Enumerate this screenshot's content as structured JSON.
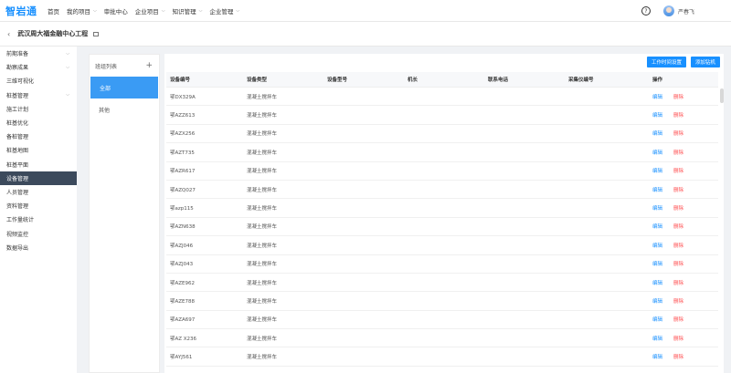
{
  "topbar": {
    "logo": "智岩通",
    "nav": [
      {
        "label": "首页",
        "dropdown": false
      },
      {
        "label": "我的项目",
        "dropdown": true
      },
      {
        "label": "审批中心",
        "dropdown": false
      },
      {
        "label": "企业项目",
        "dropdown": true
      },
      {
        "label": "知识管理",
        "dropdown": true
      },
      {
        "label": "企业管理",
        "dropdown": true
      }
    ],
    "help": "?",
    "user_name": "严春飞"
  },
  "project": {
    "back": "‹",
    "title": "武汉周大福金融中心工程"
  },
  "menu": [
    {
      "label": "前期准备",
      "dropdown": true,
      "active": false
    },
    {
      "label": "勘察成果",
      "dropdown": true,
      "active": false
    },
    {
      "label": "三维可视化",
      "dropdown": false,
      "active": false
    },
    {
      "label": "桩基管理",
      "dropdown": true,
      "active": false
    },
    {
      "label": "施工计划",
      "dropdown": false,
      "active": false
    },
    {
      "label": "桩基优化",
      "dropdown": false,
      "active": false
    },
    {
      "label": "备桩管理",
      "dropdown": false,
      "active": false
    },
    {
      "label": "桩基地图",
      "dropdown": false,
      "active": false
    },
    {
      "label": "桩基平面",
      "dropdown": false,
      "active": false
    },
    {
      "label": "设备管理",
      "dropdown": false,
      "active": true
    },
    {
      "label": "人员管理",
      "dropdown": false,
      "active": false
    },
    {
      "label": "资料管理",
      "dropdown": false,
      "active": false
    },
    {
      "label": "工作量统计",
      "dropdown": false,
      "active": false
    },
    {
      "label": "视频监控",
      "dropdown": false,
      "active": false
    },
    {
      "label": "数据导出",
      "dropdown": false,
      "active": false
    }
  ],
  "groups": {
    "title": "班组列表",
    "add": "+",
    "items": [
      {
        "label": "全部",
        "active": true
      },
      {
        "label": "其他",
        "active": false
      }
    ]
  },
  "buttons": {
    "worktime": "工作时间设置",
    "add_machine": "添加钻机"
  },
  "table": {
    "columns": [
      "设备编号",
      "设备类型",
      "设备型号",
      "机长",
      "联系电话",
      "采集仪编号",
      "操作"
    ],
    "edit_label": "编辑",
    "delete_label": "删除",
    "rows": [
      {
        "id": "鄂DX329A",
        "type": "混凝土搅拌车"
      },
      {
        "id": "鄂AZZ613",
        "type": "混凝土搅拌车"
      },
      {
        "id": "鄂AZX256",
        "type": "混凝土搅拌车"
      },
      {
        "id": "鄂AZT735",
        "type": "混凝土搅拌车"
      },
      {
        "id": "鄂AZR617",
        "type": "混凝土搅拌车"
      },
      {
        "id": "鄂AZQ027",
        "type": "混凝土搅拌车"
      },
      {
        "id": "鄂azp115",
        "type": "混凝土搅拌车"
      },
      {
        "id": "鄂AZN638",
        "type": "混凝土搅拌车"
      },
      {
        "id": "鄂AZJ046",
        "type": "混凝土搅拌车"
      },
      {
        "id": "鄂AZJ043",
        "type": "混凝土搅拌车"
      },
      {
        "id": "鄂AZE962",
        "type": "混凝土搅拌车"
      },
      {
        "id": "鄂AZE788",
        "type": "混凝土搅拌车"
      },
      {
        "id": "鄂AZA697",
        "type": "混凝土搅拌车"
      },
      {
        "id": "鄂AZ X236",
        "type": "混凝土搅拌车"
      },
      {
        "id": "鄂AYJ561",
        "type": "混凝土搅拌车"
      }
    ]
  }
}
